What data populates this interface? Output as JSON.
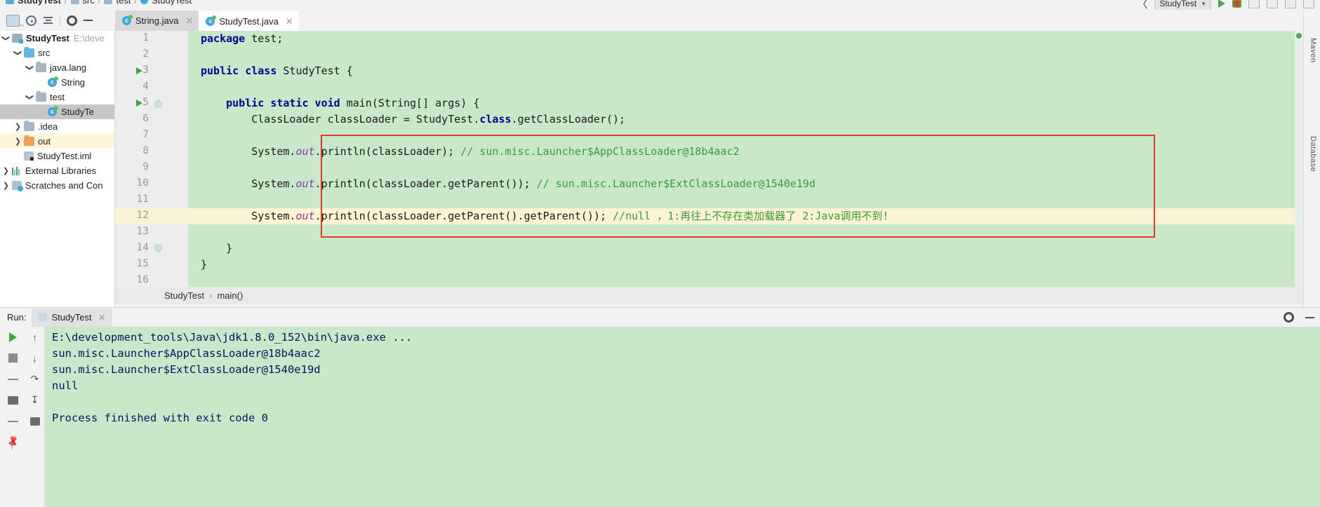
{
  "window": {
    "top_breadcrumb": [
      "StudyTest",
      "src",
      "test",
      "StudyTest"
    ],
    "run_config_name": "StudyTest"
  },
  "project_toolbar": {
    "icons": [
      "locate-file-icon",
      "select-opened-file-icon",
      "collapse-all-icon",
      "settings-gear-icon",
      "hide-icon"
    ]
  },
  "project_tree": {
    "items": [
      {
        "label": "StudyTest",
        "path": "E:\\deve",
        "icon": "project-folder-icon",
        "twisty": "down",
        "indent": 0,
        "bold": true,
        "state": "normal"
      },
      {
        "label": "src",
        "path": "",
        "icon": "source-folder-icon",
        "twisty": "down",
        "indent": 1,
        "bold": false,
        "state": "normal"
      },
      {
        "label": "java.lang",
        "path": "",
        "icon": "package-folder-icon",
        "twisty": "down",
        "indent": 2,
        "bold": false,
        "state": "normal"
      },
      {
        "label": "String",
        "path": "",
        "icon": "java-class-icon",
        "twisty": "none",
        "indent": 3,
        "bold": false,
        "state": "normal"
      },
      {
        "label": "test",
        "path": "",
        "icon": "package-folder-icon",
        "twisty": "down",
        "indent": 2,
        "bold": false,
        "state": "normal"
      },
      {
        "label": "StudyTe",
        "path": "",
        "icon": "java-class-icon",
        "twisty": "none",
        "indent": 3,
        "bold": false,
        "state": "selected"
      },
      {
        "label": ".idea",
        "path": "",
        "icon": "folder-icon",
        "twisty": "right",
        "indent": 1,
        "bold": false,
        "state": "normal"
      },
      {
        "label": "out",
        "path": "",
        "icon": "excluded-folder-icon",
        "twisty": "right",
        "indent": 1,
        "bold": false,
        "state": "highlight"
      },
      {
        "label": "StudyTest.iml",
        "path": "",
        "icon": "module-file-icon",
        "twisty": "none",
        "indent": 1,
        "bold": false,
        "state": "normal"
      },
      {
        "label": "External Libraries",
        "path": "",
        "icon": "libraries-icon",
        "twisty": "right",
        "indent": 0,
        "bold": false,
        "state": "normal"
      },
      {
        "label": "Scratches and Con",
        "path": "",
        "icon": "scratches-icon",
        "twisty": "right",
        "indent": 0,
        "bold": false,
        "state": "normal"
      }
    ]
  },
  "editor_tabs": [
    {
      "label": "String.java",
      "icon": "java-class-icon",
      "active": false,
      "closable": true
    },
    {
      "label": "StudyTest.java",
      "icon": "java-class-icon",
      "active": true,
      "closable": true
    }
  ],
  "editor": {
    "lines": [
      {
        "num": "1",
        "gutter": {
          "run": false,
          "fold": false,
          "bulb": false
        },
        "highlight": false,
        "tokens": [
          {
            "t": "package",
            "c": "kw"
          },
          {
            "t": " test;",
            "c": "pl"
          }
        ]
      },
      {
        "num": "2",
        "gutter": {
          "run": false,
          "fold": false,
          "bulb": false
        },
        "highlight": false,
        "tokens": []
      },
      {
        "num": "3",
        "gutter": {
          "run": true,
          "fold": false,
          "bulb": false
        },
        "highlight": false,
        "tokens": [
          {
            "t": "public class",
            "c": "kw"
          },
          {
            "t": " StudyTest {",
            "c": "pl"
          }
        ]
      },
      {
        "num": "4",
        "gutter": {
          "run": false,
          "fold": false,
          "bulb": false
        },
        "highlight": false,
        "tokens": []
      },
      {
        "num": "5",
        "gutter": {
          "run": true,
          "fold": true,
          "bulb": false
        },
        "highlight": false,
        "tokens": [
          {
            "t": "    ",
            "c": "pl"
          },
          {
            "t": "public static void",
            "c": "kw"
          },
          {
            "t": " main(String[] args) {",
            "c": "pl"
          }
        ]
      },
      {
        "num": "6",
        "gutter": {
          "run": false,
          "fold": false,
          "bulb": false
        },
        "highlight": false,
        "tokens": [
          {
            "t": "        ClassLoader classLoader = StudyTest.",
            "c": "pl"
          },
          {
            "t": "class",
            "c": "kw"
          },
          {
            "t": ".getClassLoader();",
            "c": "pl"
          }
        ]
      },
      {
        "num": "7",
        "gutter": {
          "run": false,
          "fold": false,
          "bulb": false
        },
        "highlight": false,
        "tokens": []
      },
      {
        "num": "8",
        "gutter": {
          "run": false,
          "fold": false,
          "bulb": false
        },
        "highlight": false,
        "tokens": [
          {
            "t": "        System.",
            "c": "pl"
          },
          {
            "t": "out",
            "c": "it"
          },
          {
            "t": ".println(classLoader); ",
            "c": "pl"
          },
          {
            "t": "// sun.misc.Launcher$AppClassLoader@18b4aac2",
            "c": "cm"
          }
        ]
      },
      {
        "num": "9",
        "gutter": {
          "run": false,
          "fold": false,
          "bulb": false
        },
        "highlight": false,
        "tokens": []
      },
      {
        "num": "10",
        "gutter": {
          "run": false,
          "fold": false,
          "bulb": false
        },
        "highlight": false,
        "tokens": [
          {
            "t": "        System.",
            "c": "pl"
          },
          {
            "t": "out",
            "c": "it"
          },
          {
            "t": ".println(classLoader.getParent()); ",
            "c": "pl"
          },
          {
            "t": "// sun.misc.Launcher$ExtClassLoader@1540e19d",
            "c": "cm"
          }
        ]
      },
      {
        "num": "11",
        "gutter": {
          "run": false,
          "fold": false,
          "bulb": false
        },
        "highlight": false,
        "tokens": []
      },
      {
        "num": "12",
        "gutter": {
          "run": false,
          "fold": false,
          "bulb": true
        },
        "highlight": true,
        "tokens": [
          {
            "t": "        System.",
            "c": "pl"
          },
          {
            "t": "out",
            "c": "it"
          },
          {
            "t": ".println(classLoader.getParent().getParent()); ",
            "c": "pl"
          },
          {
            "t": "//null ，1:再往上不存在类加载器了 2:Java调用不到!",
            "c": "cm"
          }
        ]
      },
      {
        "num": "13",
        "gutter": {
          "run": false,
          "fold": false,
          "bulb": false
        },
        "highlight": false,
        "tokens": []
      },
      {
        "num": "14",
        "gutter": {
          "run": false,
          "fold": true,
          "bulb": false
        },
        "highlight": false,
        "tokens": [
          {
            "t": "    }",
            "c": "pl"
          }
        ]
      },
      {
        "num": "15",
        "gutter": {
          "run": false,
          "fold": false,
          "bulb": false
        },
        "highlight": false,
        "tokens": [
          {
            "t": "}",
            "c": "pl"
          }
        ]
      },
      {
        "num": "16",
        "gutter": {
          "run": false,
          "fold": false,
          "bulb": false
        },
        "highlight": false,
        "tokens": []
      }
    ],
    "annotation_box": {
      "color": "#dd3b2a",
      "label": "red-highlight-rectangle"
    }
  },
  "breadcrumb_bar": {
    "items": [
      "StudyTest",
      "main()"
    ],
    "separator": "›"
  },
  "run_panel": {
    "label": "Run:",
    "tab_label": "StudyTest",
    "console_lines": [
      "E:\\development_tools\\Java\\jdk1.8.0_152\\bin\\java.exe ...",
      "sun.misc.Launcher$AppClassLoader@18b4aac2",
      "sun.misc.Launcher$ExtClassLoader@1540e19d",
      "null",
      "",
      "Process finished with exit code 0"
    ],
    "toolbar_icons": [
      "rerun-icon",
      "stop-icon",
      "print-toggle-icon",
      "pin-icon"
    ],
    "toolbar_icons2": [
      "scroll-up-icon",
      "scroll-down-icon",
      "soft-wrap-icon",
      "scroll-to-end-icon",
      "print-icon"
    ],
    "header_right_icons": [
      "settings-gear-icon",
      "hide-icon"
    ]
  },
  "right_strip": {
    "labels": [
      "Maven",
      "Database"
    ]
  },
  "colors": {
    "editor_bg": "#c9e7c9",
    "keyword": "#00008f",
    "comment": "#3c9a3c",
    "field_italic": "#8d36a8",
    "console_text": "#11115c",
    "annotation": "#dd3b2a",
    "caret_line": "#faf3d4"
  }
}
